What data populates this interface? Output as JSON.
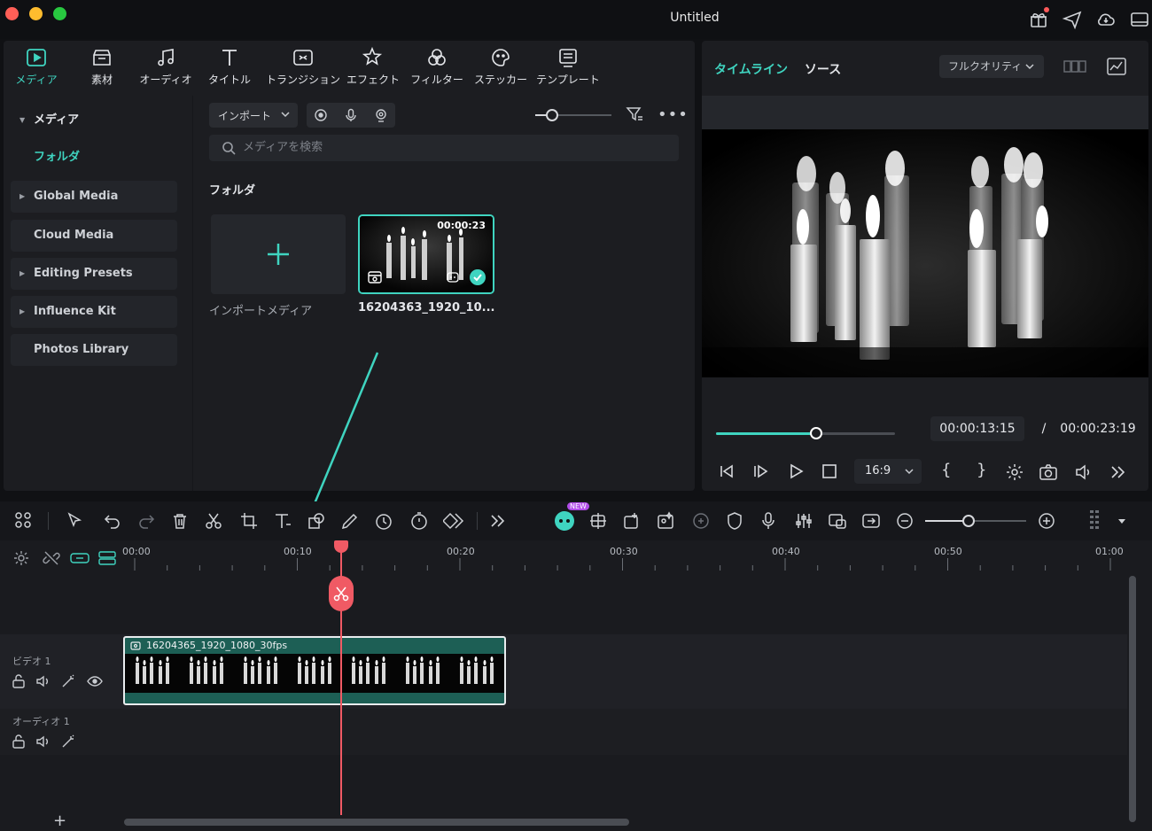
{
  "window": {
    "title": "Untitled"
  },
  "tabs": [
    {
      "label": "メディア",
      "icon": "media-icon",
      "active": true
    },
    {
      "label": "素材",
      "icon": "stock-icon"
    },
    {
      "label": "オーディオ",
      "icon": "music-note-icon"
    },
    {
      "label": "タイトル",
      "icon": "title-t-icon"
    },
    {
      "label": "トランジション",
      "icon": "transition-icon"
    },
    {
      "label": "エフェクト",
      "icon": "effects-star-icon"
    },
    {
      "label": "フィルター",
      "icon": "filter-icon"
    },
    {
      "label": "ステッカー",
      "icon": "sticker-icon"
    },
    {
      "label": "テンプレート",
      "icon": "template-icon"
    }
  ],
  "sidebar": {
    "items": [
      {
        "label": "メディア",
        "caret": "▼"
      },
      {
        "label": "フォルダ"
      },
      {
        "label": "Global Media",
        "caret": "▶"
      },
      {
        "label": "Cloud Media"
      },
      {
        "label": "Editing Presets",
        "caret": "▶"
      },
      {
        "label": "Influence Kit",
        "caret": "▶"
      },
      {
        "label": "Photos Library"
      }
    ]
  },
  "media": {
    "import_label": "インポート",
    "search_placeholder": "メディアを検索",
    "folder_heading": "フォルダ",
    "import_media_label": "インポートメディア",
    "clip": {
      "name": "16204363_1920_10...",
      "duration": "00:00:23"
    }
  },
  "preview": {
    "tab_timeline": "タイムライン",
    "tab_source": "ソース",
    "quality": "フルクオリティ",
    "current_time": "00:00:13:15",
    "separator": "/",
    "total_time": "00:00:23:19",
    "progress": 0.56,
    "aspect": "16:9",
    "bracket_in": "{",
    "bracket_out": "}"
  },
  "timeline": {
    "ruler": [
      "00:00",
      "00:10",
      "00:20",
      "00:30",
      "00:40",
      "00:50",
      "01:00"
    ],
    "tracks": {
      "video": "ビデオ 1",
      "audio": "オーディオ 1"
    },
    "clip_name": "16204365_1920_1080_30fps",
    "add_label": "+",
    "ai_badge": "NEW"
  },
  "colors": {
    "accent": "#3fd4c0",
    "playhead": "#f05a64",
    "clip": "#1d5f55"
  }
}
